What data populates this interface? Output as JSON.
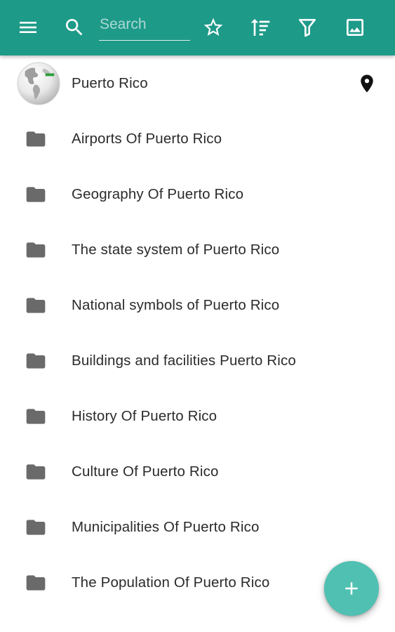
{
  "toolbar": {
    "menu_icon": "menu-icon",
    "search_icon": "search-icon",
    "search_placeholder": "Search",
    "search_value": "",
    "actions": [
      "star-icon",
      "sort-icon",
      "filter-icon",
      "image-icon"
    ],
    "background": "#1e9a89"
  },
  "header_item": {
    "label": "Puerto Rico",
    "icon": "globe-icon",
    "trailing_icon": "location-pin-icon"
  },
  "folders": [
    {
      "label": "Airports Of Puerto Rico",
      "icon": "folder-icon"
    },
    {
      "label": "Geography Of Puerto Rico",
      "icon": "folder-icon"
    },
    {
      "label": "The state system of Puerto Rico",
      "icon": "folder-icon"
    },
    {
      "label": "National symbols of Puerto Rico",
      "icon": "folder-icon"
    },
    {
      "label": "Buildings and facilities Puerto Rico",
      "icon": "folder-icon"
    },
    {
      "label": "History Of Puerto Rico",
      "icon": "folder-icon"
    },
    {
      "label": "Culture Of Puerto Rico",
      "icon": "folder-icon"
    },
    {
      "label": "Municipalities Of Puerto Rico",
      "icon": "folder-icon"
    },
    {
      "label": "The Population Of Puerto Rico",
      "icon": "folder-icon"
    }
  ],
  "fab": {
    "icon": "plus-icon",
    "color": "#4fc0b2"
  }
}
